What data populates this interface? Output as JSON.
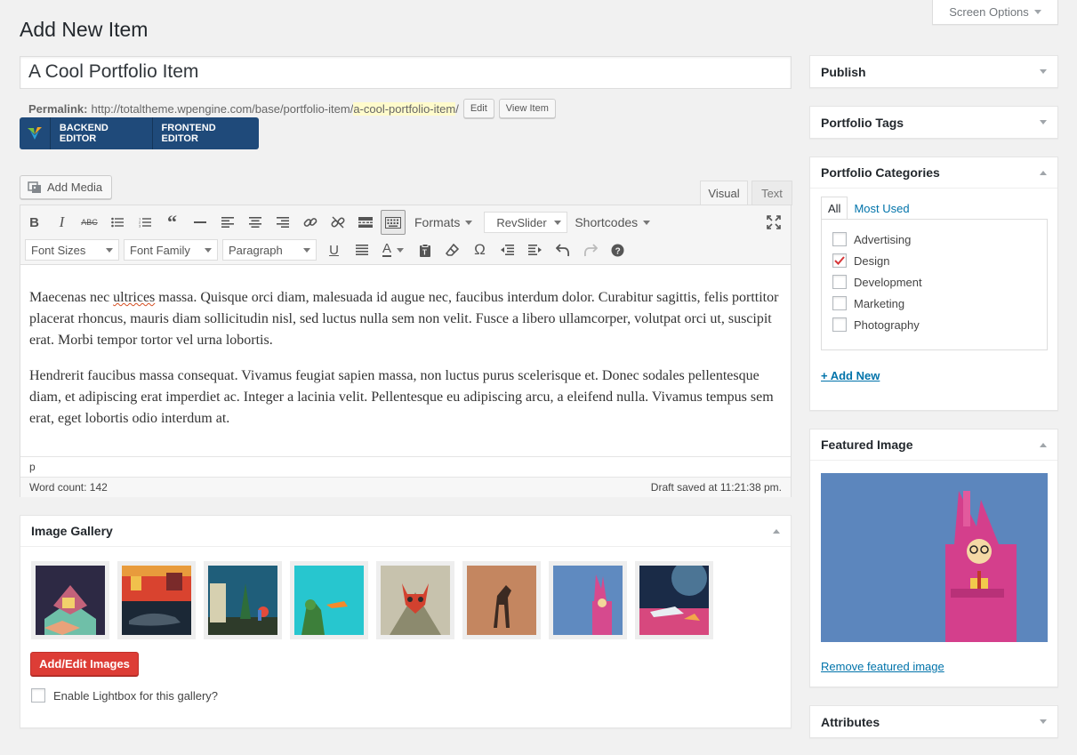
{
  "screen_options": {
    "label": "Screen Options"
  },
  "page": {
    "title": "Add New Item"
  },
  "post": {
    "title": "A Cool Portfolio Item",
    "permalink_label": "Permalink:",
    "permalink_base": "http://totaltheme.wpengine.com/base/portfolio-item/",
    "permalink_slug": "a-cool-portfolio-item",
    "permalink_trailing": "/",
    "edit_label": "Edit",
    "view_label": "View Item"
  },
  "vc": {
    "backend_label": "BACKEND EDITOR",
    "frontend_label": "FRONTEND EDITOR",
    "brand_color": "#1f4a7a"
  },
  "editor": {
    "add_media_label": "Add Media",
    "tab_visual": "Visual",
    "tab_text": "Text",
    "toolbar_row1": {
      "formats": "Formats",
      "revslider": "RevSlider",
      "shortcodes": "Shortcodes"
    },
    "toolbar_row2": {
      "font_sizes": "Font Sizes",
      "font_family": "Font Family",
      "paragraph": "Paragraph"
    },
    "paragraphs": [
      {
        "before": "Maecenas nec ",
        "misspelled": "ultrices",
        "after": " massa. Quisque orci diam, malesuada id augue nec, faucibus interdum dolor. Curabitur sagittis, felis porttitor placerat rhoncus, mauris diam sollicitudin nisl, sed luctus nulla sem non velit. Fusce a libero ullamcorper, volutpat orci ut, suscipit erat. Morbi tempor tortor vel urna lobortis."
      },
      {
        "text": "Hendrerit faucibus massa consequat. Vivamus feugiat sapien massa, non luctus purus scelerisque et. Donec sodales pellentesque diam, et adipiscing erat imperdiet ac. Integer a lacinia velit. Pellentesque eu adipiscing arcu, a eleifend nulla. Vivamus tempus sem erat, eget lobortis odio interdum at."
      }
    ],
    "path": "p",
    "word_count": "Word count: 142",
    "draft_status": "Draft saved at 11:21:38 pm."
  },
  "gallery": {
    "title": "Image Gallery",
    "add_edit_label": "Add/Edit Images",
    "lightbox_label": "Enable Lightbox for this gallery?",
    "button_color": "#dd3d36"
  },
  "sidebar": {
    "publish": "Publish",
    "tags": "Portfolio Tags",
    "categories": {
      "title": "Portfolio Categories",
      "tab_all": "All",
      "tab_most_used": "Most Used",
      "items": [
        {
          "label": "Advertising",
          "checked": false
        },
        {
          "label": "Design",
          "checked": true
        },
        {
          "label": "Development",
          "checked": false
        },
        {
          "label": "Marketing",
          "checked": false
        },
        {
          "label": "Photography",
          "checked": false
        }
      ],
      "add_new": "+ Add New"
    },
    "featured": {
      "title": "Featured Image",
      "remove_label": "Remove featured image"
    },
    "attributes": "Attributes"
  }
}
